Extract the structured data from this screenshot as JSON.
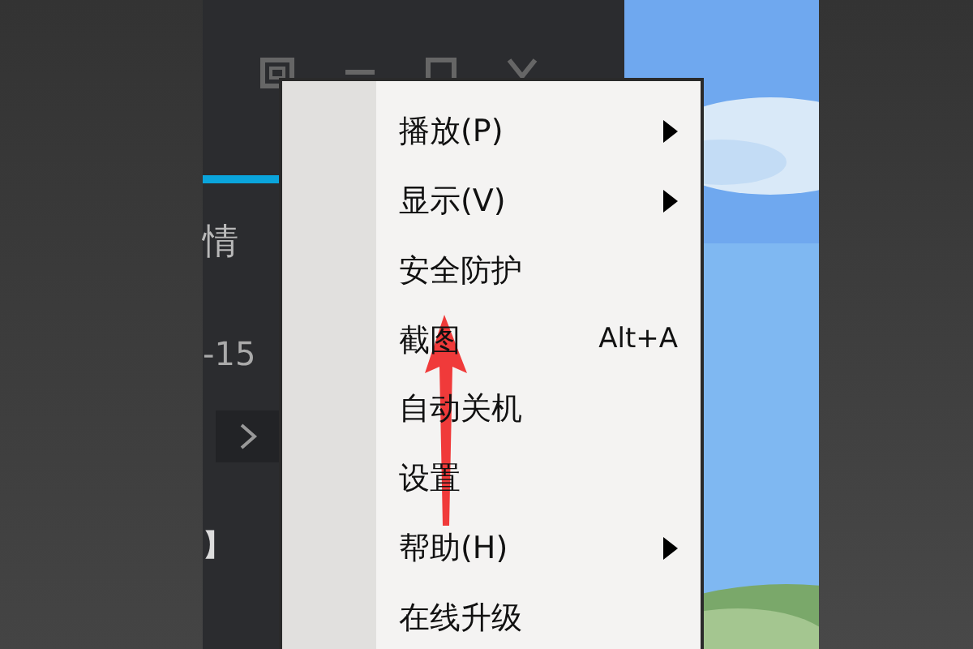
{
  "app_window": {
    "tab_label": "情",
    "date_fragment": "-15",
    "list_fragment": "】"
  },
  "context_menu": {
    "items": [
      {
        "label": "播放(P)",
        "submenu": true
      },
      {
        "label": "显示(V)",
        "submenu": true
      },
      {
        "label": "安全防护",
        "submenu": false
      },
      {
        "label": "截图",
        "shortcut": "Alt+A",
        "submenu": false
      },
      {
        "label": "自动关机",
        "submenu": false
      },
      {
        "label": "设置",
        "submenu": false
      },
      {
        "label": "帮助(H)",
        "submenu": true
      },
      {
        "label": "在线升级",
        "submenu": false
      }
    ]
  },
  "annotation": {
    "kind": "arrow"
  }
}
